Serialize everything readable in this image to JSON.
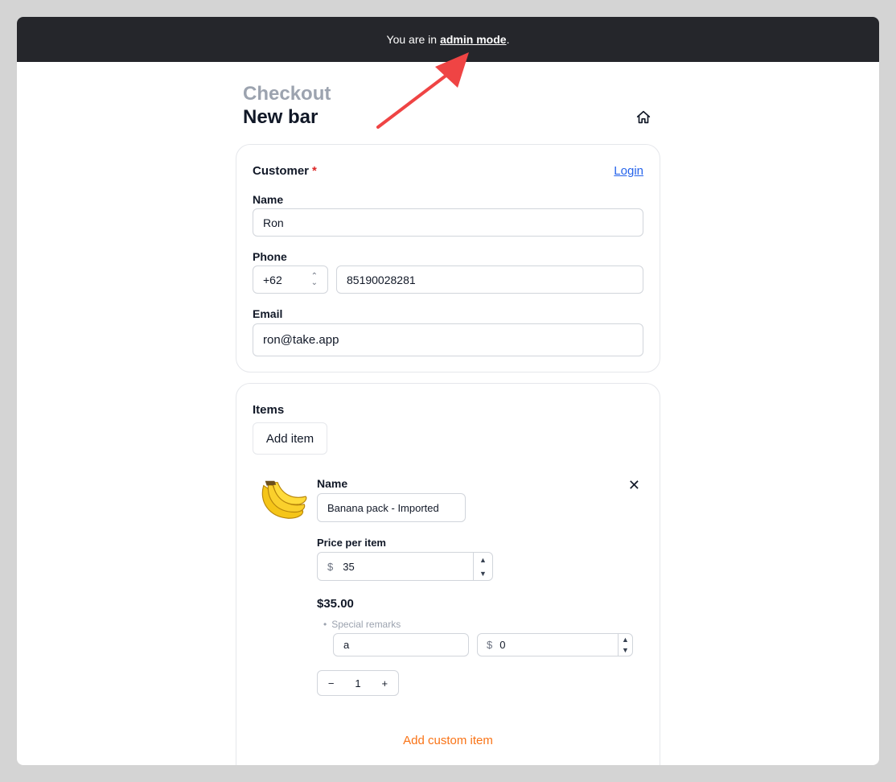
{
  "admin_bar": {
    "prefix": "You are in",
    "link": "admin mode",
    "suffix": "."
  },
  "header": {
    "crumb": "Checkout",
    "title": "New bar",
    "home_icon": "home-icon"
  },
  "customer": {
    "title": "Customer",
    "required_mark": "*",
    "login_label": "Login",
    "name_label": "Name",
    "name_value": "Ron",
    "phone_label": "Phone",
    "country_code": "+62",
    "phone_value": "85190028281",
    "email_label": "Email",
    "email_value": "ron@take.app"
  },
  "items": {
    "title": "Items",
    "add_item_label": "Add item",
    "list": [
      {
        "image_icon": "banana-icon",
        "name_label": "Name",
        "name_value": "Banana pack - Imported",
        "price_label": "Price per item",
        "currency": "$",
        "price_value": "35",
        "total": "$35.00",
        "remarks_label": "Special remarks",
        "remark_value": "a",
        "remark_price": "0",
        "quantity": "1",
        "minus": "−",
        "plus": "+"
      }
    ],
    "add_custom_label": "Add custom item"
  },
  "colors": {
    "admin_bar": "#25262b",
    "link": "#2563eb",
    "accent": "#f97316",
    "required": "#dc2626",
    "annotation_arrow": "#ef4444"
  }
}
